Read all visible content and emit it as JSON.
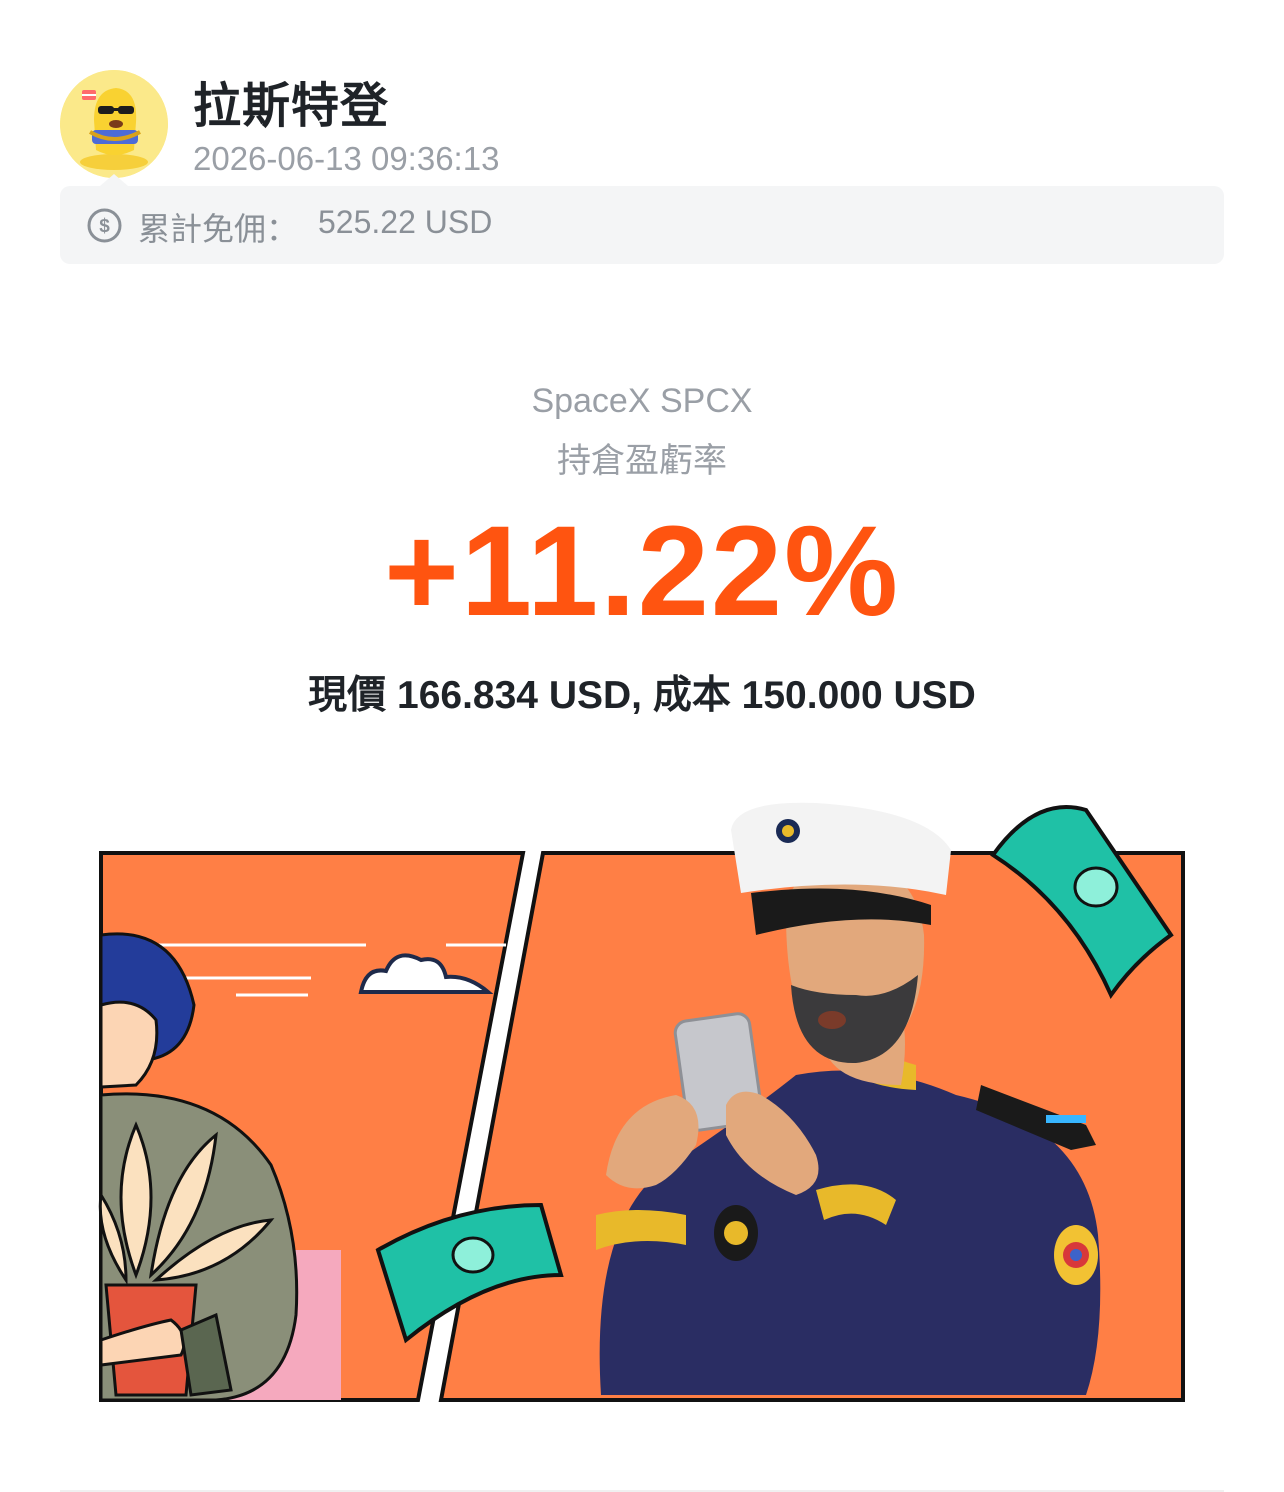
{
  "post": {
    "username": "拉斯特登",
    "timestamp": "2026-06-13 09:36:13",
    "avatar_icon": "mascot-avatar-icon"
  },
  "fee_banner": {
    "icon": "dollar-circle-icon",
    "label": "累計免佣：",
    "value": "525.22 USD"
  },
  "position": {
    "stock_name": "SpaceX SPCX",
    "metric_label": "持倉盈虧率",
    "pnl_rate": "+11.22%",
    "price_line": "現價 166.834 USD,  成本 150.000 USD"
  },
  "illustration": {
    "description_icon": "captain-with-phone-illustration"
  },
  "colors": {
    "profit": "#ff5410",
    "panel_orange": "#ff7f45",
    "money_green": "#1fc1a6"
  }
}
